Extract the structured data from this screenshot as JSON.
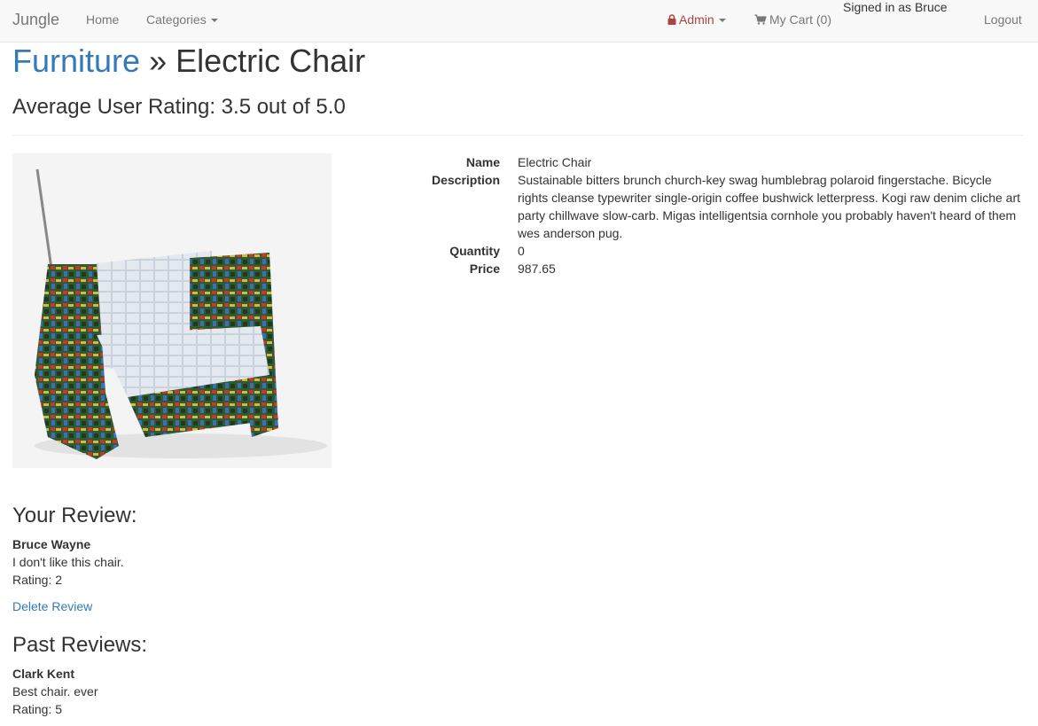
{
  "navbar": {
    "brand": "Jungle",
    "home": "Home",
    "categories": "Categories",
    "admin": "Admin",
    "cart": "My Cart (0)",
    "signed_in": "Signed in as Bruce",
    "logout": "Logout"
  },
  "header": {
    "category": "Furniture",
    "separator": " » ",
    "product_name": "Electric Chair",
    "average_rating": "Average User Rating: 3.5 out of 5.0"
  },
  "product": {
    "name_label": "Name",
    "name": "Electric Chair",
    "description_label": "Description",
    "description": "Sustainable bitters brunch church-key swag humblebrag polaroid fingerstache. Bicycle rights cleanse typewriter single-origin coffee bushwick letterpress. Kogi raw denim cliche art party chillwave slow-carb. Migas intelligentsia cornhole you probably haven't heard of them wes anderson pug.",
    "quantity_label": "Quantity",
    "quantity": "0",
    "price_label": "Price",
    "price": "987.65"
  },
  "your_review": {
    "heading": "Your Review:",
    "author": "Bruce Wayne",
    "text": "I don't like this chair.",
    "rating": "Rating: 2",
    "delete_label": "Delete Review"
  },
  "past_reviews": {
    "heading": "Past Reviews:",
    "items": [
      {
        "author": "Clark Kent",
        "text": "Best chair. ever",
        "rating": "Rating: 5"
      }
    ]
  },
  "colors": {
    "link": "#337ab7",
    "admin": "#a94442",
    "navbar_bg": "#f8f8f8"
  },
  "icons": {
    "admin": "lock-icon",
    "cart": "shopping-cart-icon"
  }
}
